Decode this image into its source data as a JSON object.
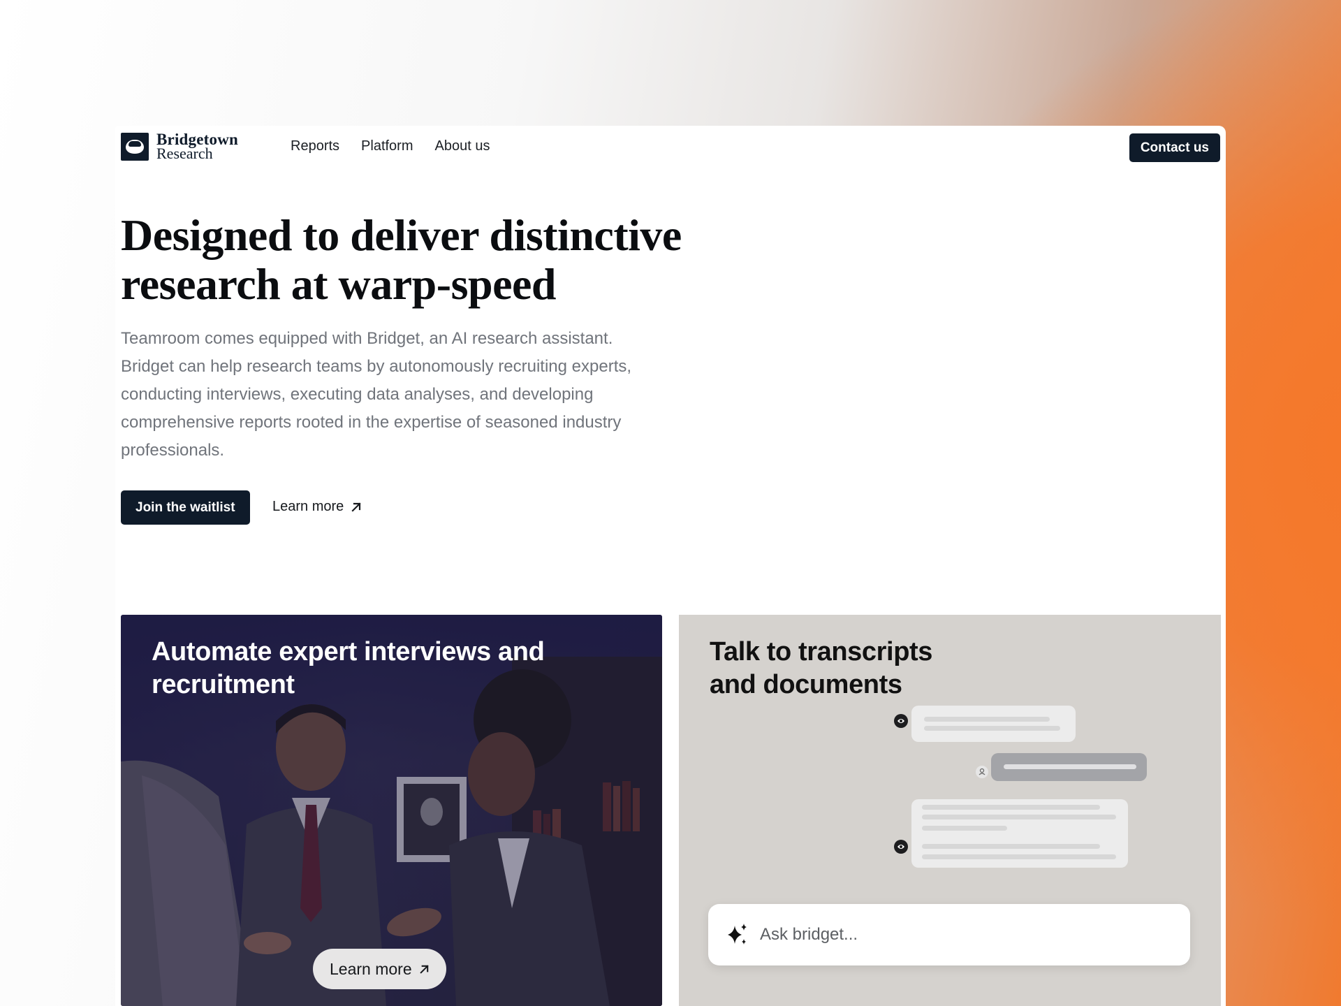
{
  "brand": {
    "line1": "Bridgetown",
    "line2": "Research"
  },
  "nav": {
    "items": [
      {
        "label": "Reports"
      },
      {
        "label": "Platform"
      },
      {
        "label": "About us"
      }
    ]
  },
  "header": {
    "contact_label": "Contact us"
  },
  "hero": {
    "title_line1": "Designed to deliver distinctive",
    "title_line2": "research at warp-speed",
    "description": "Teamroom comes equipped with Bridget, an AI research assistant. Bridget can help research teams by autonomously recruiting experts, conducting interviews, executing data analyses, and developing comprehensive reports rooted in the expertise of seasoned industry professionals.",
    "primary_cta": "Join the waitlist",
    "secondary_cta": "Learn more"
  },
  "cards": [
    {
      "title_line1": "Automate expert interviews and",
      "title_line2": "recruitment",
      "button_label": "Learn more"
    },
    {
      "title_line1": "Talk to transcripts",
      "title_line2": "and documents",
      "input_placeholder": "Ask bridget..."
    }
  ],
  "colors": {
    "brand_dark": "#0f1b2a",
    "accent_orange": "#f07a2f",
    "text_muted": "#70747b"
  },
  "icons": {
    "arrow": "arrow-up-right-icon",
    "sparkle": "sparkle-icon"
  }
}
